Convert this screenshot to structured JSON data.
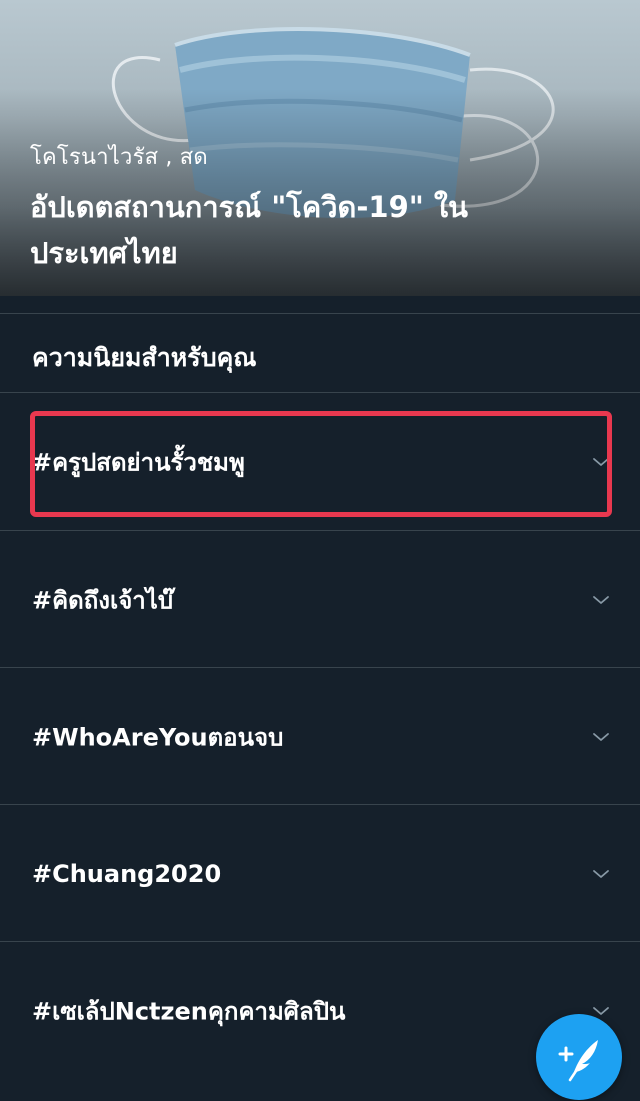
{
  "hero": {
    "meta": "โคโรนาไวรัส , สด",
    "title": "อัปเดตสถานการณ์ \"โควิด-19\" ในประเทศไทย"
  },
  "section": {
    "title": "ความนิยมสำหรับคุณ"
  },
  "trends": [
    {
      "label": "#ครูปสดย่านรั้วชมพู"
    },
    {
      "label": "#คิดถึงเจ้าไบ๊"
    },
    {
      "label": "#WhoAreYouตอนจบ"
    },
    {
      "label": "#Chuang2020"
    },
    {
      "label": "#เซเล้ปNctzenคุกคามศิลปิน"
    }
  ],
  "icons": {
    "row_menu": "chevron-down-icon",
    "fab": "compose-tweet-icon"
  },
  "colors": {
    "background": "#15202b",
    "divider": "#38444d",
    "accent": "#1da1f2",
    "highlight": "#e8384f"
  }
}
